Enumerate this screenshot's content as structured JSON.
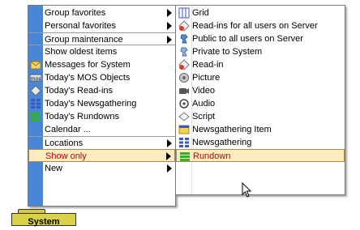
{
  "main_menu": {
    "items": [
      {
        "label": "Group favorites",
        "submenu": true
      },
      {
        "label": "Personal favorites",
        "submenu": true
      },
      {
        "label": "Group maintenance",
        "submenu": true
      },
      {
        "label": "Show oldest items"
      },
      {
        "label": "Messages for System",
        "icon": "envelope-icon"
      },
      {
        "label": "Today's MOS Objects",
        "icon": "mos-icon"
      },
      {
        "label": "Today's Read-ins",
        "icon": "diamond-icon"
      },
      {
        "label": "Today's Newsgathering",
        "icon": "newsgathering-grid-icon"
      },
      {
        "label": "Today's Rundowns",
        "icon": "rundown-icon"
      },
      {
        "label": "Calendar ..."
      },
      {
        "label": "Locations",
        "submenu": true
      },
      {
        "label": "Show only",
        "submenu": true,
        "highlighted": true
      },
      {
        "label": "New",
        "submenu": true
      }
    ]
  },
  "sub_menu": {
    "items": [
      {
        "label": "Grid",
        "icon": "grid-icon"
      },
      {
        "label": "Read-ins for all users on Server",
        "icon": "read-in-server-icon"
      },
      {
        "label": "Public to all users on Server",
        "icon": "public-server-icon"
      },
      {
        "label": "Private to System",
        "icon": "private-icon"
      },
      {
        "label": "Read-in",
        "icon": "read-in-icon"
      },
      {
        "label": "Picture",
        "icon": "picture-icon"
      },
      {
        "label": "Video",
        "icon": "video-icon"
      },
      {
        "label": "Audio",
        "icon": "audio-icon"
      },
      {
        "label": "Script",
        "icon": "script-icon"
      },
      {
        "label": "Newsgathering Item",
        "icon": "newsgathering-item-icon"
      },
      {
        "label": "Newsgathering",
        "icon": "newsgathering-grid-icon"
      },
      {
        "label": "Rundown",
        "icon": "rundown-icon",
        "highlighted": true
      }
    ]
  },
  "folder": {
    "label": "System"
  },
  "colors": {
    "highlight_bg": "#fbecc2",
    "highlight_text": "#c00000",
    "strip": "#4a86d8"
  }
}
